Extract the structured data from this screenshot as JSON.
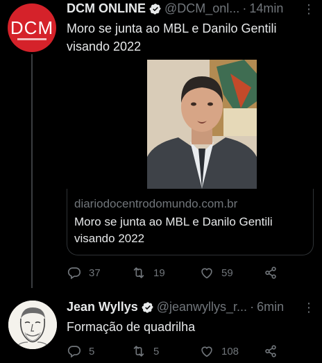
{
  "tweets": [
    {
      "author": {
        "name": "DCM ONLINE",
        "handle": "@DCM_onl...",
        "avatar_text": "DCM",
        "avatar_color": "#d5222a",
        "verified": true
      },
      "time": "14min",
      "separator": "·",
      "more_label": "⋮",
      "text_lines": [
        "Moro se junta ao MBL e Danilo Gentili",
        "visando 2022"
      ],
      "media": {
        "kind": "photo-of-man-in-suit"
      },
      "link_card": {
        "domain": "diariodocentrodomundo.com.br",
        "title_lines": [
          "Moro se junta ao MBL e Danilo Gentili",
          "visando 2022"
        ]
      },
      "stats": {
        "replies": "37",
        "retweets": "19",
        "likes": "59"
      }
    },
    {
      "author": {
        "name": "Jean Wyllys",
        "handle": "@jeanwyllys_r...",
        "avatar_kind": "illustrated-portrait",
        "verified": true
      },
      "time": "6min",
      "separator": "·",
      "more_label": "⋮",
      "text_lines": [
        "Formação de quadrilha"
      ],
      "stats": {
        "replies": "5",
        "retweets": "5",
        "likes": "108"
      }
    }
  ],
  "colors": {
    "background": "#000000",
    "text": "#e7e9ea",
    "muted": "#71767b",
    "verified": "#1d9bf0",
    "border": "#2f3336"
  },
  "icons": [
    "verified-badge-icon",
    "more-icon",
    "reply-icon",
    "retweet-icon",
    "like-icon",
    "share-icon"
  ]
}
